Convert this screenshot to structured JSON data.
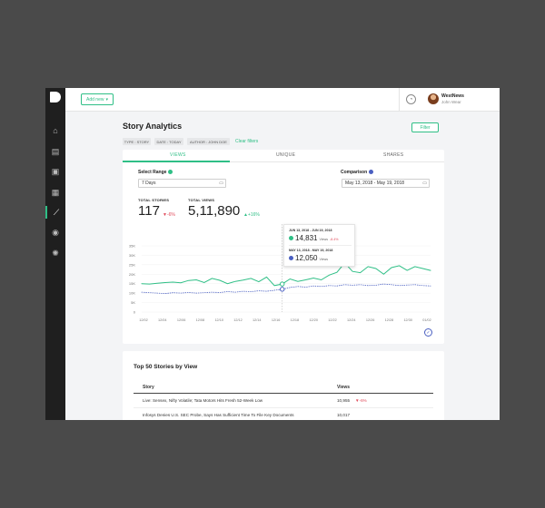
{
  "header": {
    "add_new_label": "Add new",
    "user_name": "WestNews",
    "user_sub": "John Wear"
  },
  "page": {
    "title": "Story Analytics",
    "filter_label": "Filter",
    "chips": [
      "TYPE : STORY",
      "DATE : TODAY",
      "AUTHOR : JOHN DOE"
    ],
    "clear_filters": "Clear filters"
  },
  "tabs": [
    "VIEWS",
    "UNIQUE",
    "SHARES"
  ],
  "controls": {
    "select_range_label": "Select Range",
    "select_range_value": "7 Days",
    "comparison_label": "Comparison",
    "comparison_value": "May 13, 2018 - May 19, 2018"
  },
  "stats": {
    "total_stories_label": "TOTAL STORIES",
    "total_stories_value": "117",
    "total_stories_change": "-6%",
    "total_views_label": "TOTAL VIEWS",
    "total_views_value": "5,11,890",
    "total_views_change": "+16%"
  },
  "tooltip": {
    "range1": "JUN 13, 2018 - JUN 19, 2018",
    "value1": "14,831",
    "unit": "Views",
    "change1": "-8.4%",
    "range2": "MAY 13, 2018 - MAY 19, 2018",
    "value2": "12,050"
  },
  "colors": {
    "accent": "#2fbf86",
    "comparison": "#4a5fc1",
    "negative": "#e04a5a"
  },
  "chart_data": {
    "type": "line",
    "y_ticks": [
      "35K",
      "30K",
      "25K",
      "20K",
      "15K",
      "10K",
      "5K",
      "0"
    ],
    "ylim": [
      0,
      35000
    ],
    "x_ticks": [
      "12/02",
      "12/04",
      "12/06",
      "12/08",
      "12/10",
      "12/12",
      "12/14",
      "12/16",
      "12/18",
      "12/20",
      "12/22",
      "12/24",
      "12/26",
      "12/28",
      "12/30",
      "01/02"
    ],
    "series": [
      {
        "name": "current",
        "style": "solid",
        "color": "#2fbf86",
        "values": [
          15000,
          14800,
          15200,
          15600,
          15800,
          15500,
          16700,
          17000,
          15600,
          17800,
          16800,
          15000,
          16200,
          16900,
          17800,
          16000,
          18500,
          14000,
          14831,
          17500,
          16200,
          17000,
          18000,
          17000,
          19500,
          21000,
          26000,
          21500,
          20800,
          24000,
          23000,
          20000,
          23500,
          24500,
          22000,
          24000,
          23000,
          22000
        ]
      },
      {
        "name": "comparison",
        "style": "dotted",
        "color": "#4a5fc1",
        "values": [
          10500,
          10200,
          10000,
          9800,
          10200,
          10000,
          10300,
          10000,
          10200,
          10500,
          10300,
          10800,
          10500,
          11000,
          10800,
          11200,
          11000,
          11500,
          12050,
          13000,
          13500,
          13200,
          13800,
          13500,
          14000,
          13800,
          14500,
          14200,
          14500,
          14000,
          14200,
          14800,
          14500,
          14000,
          14300,
          14500,
          14000,
          13800
        ]
      }
    ],
    "highlight_index": 18
  },
  "table": {
    "title": "Top 50 Stories by View",
    "col_story": "Story",
    "col_views": "Views",
    "rows": [
      {
        "story": "Live: Sensex, Nifty Volatile; Tata Motors Hits Fresh 52-Week Low",
        "views": "10,955",
        "change": "-6%"
      },
      {
        "story": "Infosys Denies U.S. SEC Probe, Says Has Sufficient Time To File Key Documents",
        "views": "10,017",
        "change": ""
      }
    ]
  }
}
